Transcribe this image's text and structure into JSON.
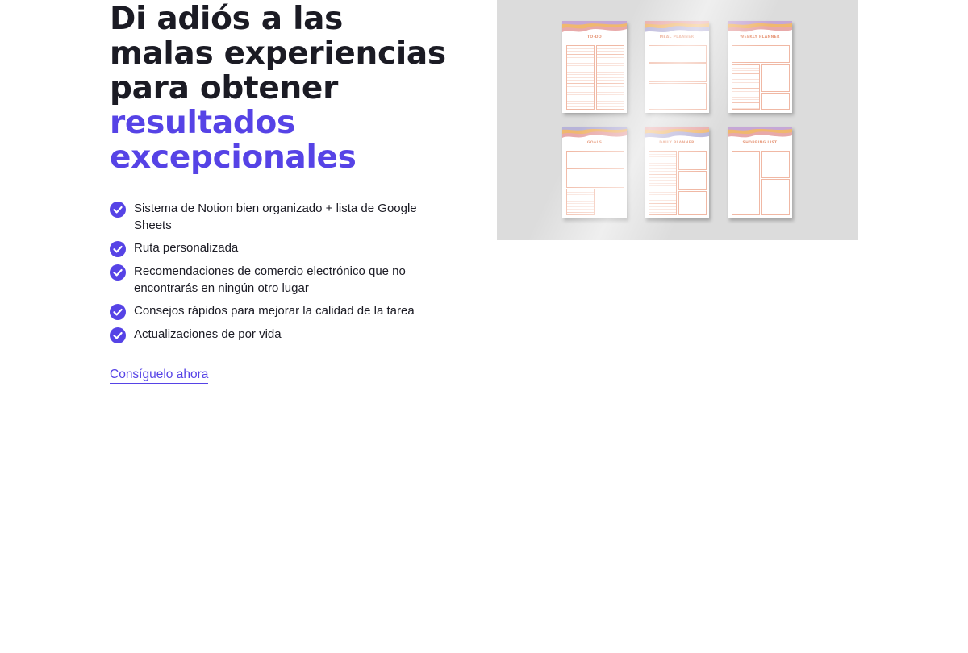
{
  "headline": {
    "plain": "Di adiós a las malas experiencias para obtener ",
    "accent": "resultados excepcionales"
  },
  "features": [
    "Sistema de Notion bien organizado + lista de Google Sheets",
    "Ruta personalizada",
    "Recomendaciones de comercio electrónico que no encontrarás en ningún otro lugar",
    "Consejos rápidos para mejorar la calidad de la tarea",
    "Actualizaciones de por vida"
  ],
  "cta": {
    "label": "Consíguelo ahora"
  },
  "mockup": {
    "sheets": [
      "TO-DO",
      "MEAL PLANNER",
      "WEEKLY PLANNER",
      "GOALS",
      "DAILY PLANNER",
      "SHOPPING LIST"
    ]
  },
  "colors": {
    "accent": "#5643e6",
    "text": "#1b1b24",
    "mock_bg": "#dcdcdc",
    "sheet_line": "#f0b8a4"
  },
  "icons": {
    "feature_bullet": "check-circle-icon"
  }
}
